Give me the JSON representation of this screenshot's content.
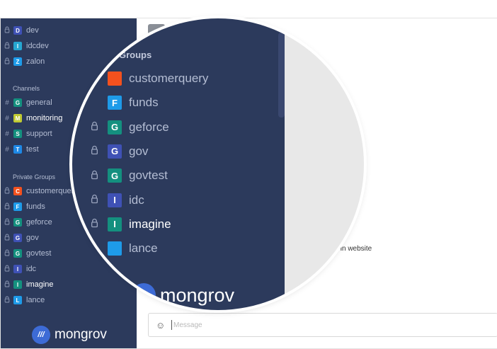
{
  "sidebar": {
    "direct": [
      {
        "prefix": "lock",
        "letter": "D",
        "color": "#3f51b5",
        "name": "dev"
      },
      {
        "prefix": "lock",
        "letter": "I",
        "color": "#26a6d1",
        "name": "idcdev"
      },
      {
        "prefix": "lock",
        "letter": "Z",
        "color": "#1e9be9",
        "name": "zalon"
      }
    ],
    "channels_title": "Channels",
    "channels": [
      {
        "prefix": "#",
        "letter": "G",
        "color": "#14907f",
        "name": "general",
        "active": false
      },
      {
        "prefix": "#",
        "letter": "M",
        "color": "#c0ca33",
        "name": "monitoring",
        "active": true
      },
      {
        "prefix": "#",
        "letter": "S",
        "color": "#14907f",
        "name": "support",
        "active": false
      },
      {
        "prefix": "#",
        "letter": "T",
        "color": "#1e88e5",
        "name": "test",
        "active": false
      }
    ],
    "groups_title": "Private Groups",
    "groups": [
      {
        "letter": "C",
        "color": "#f4511e",
        "name": "customerquery",
        "active": false
      },
      {
        "letter": "F",
        "color": "#1e9be9",
        "name": "funds",
        "active": false
      },
      {
        "letter": "G",
        "color": "#14907f",
        "name": "geforce",
        "active": false
      },
      {
        "letter": "G",
        "color": "#3f51b5",
        "name": "gov",
        "active": false
      },
      {
        "letter": "G",
        "color": "#14907f",
        "name": "govtest",
        "active": false
      },
      {
        "letter": "I",
        "color": "#3f51b5",
        "name": "idc",
        "active": false
      },
      {
        "letter": "I",
        "color": "#14907f",
        "name": "imagine",
        "active": true
      },
      {
        "letter": "L",
        "color": "#1e9be9",
        "name": "lance",
        "active": false
      }
    ],
    "brand": {
      "mark": "///",
      "name": "mongrov"
    }
  },
  "main": {
    "message_snippet": "x in website"
  },
  "composer": {
    "placeholder": "Message",
    "emoji_icon": "smile-icon"
  },
  "magnifier": {
    "section_title": "Groups",
    "rows": [
      {
        "prefix": "",
        "letter": "",
        "color": "#f4511e",
        "name": "customerquery",
        "active": false
      },
      {
        "prefix": "",
        "letter": "F",
        "color": "#1e9be9",
        "name": "funds",
        "active": false
      },
      {
        "prefix": "lock",
        "letter": "G",
        "color": "#14907f",
        "name": "geforce",
        "active": false
      },
      {
        "prefix": "lock",
        "letter": "G",
        "color": "#3f51b5",
        "name": "gov",
        "active": false
      },
      {
        "prefix": "lock",
        "letter": "G",
        "color": "#14907f",
        "name": "govtest",
        "active": false
      },
      {
        "prefix": "lock",
        "letter": "I",
        "color": "#3f51b5",
        "name": "idc",
        "active": false
      },
      {
        "prefix": "lock",
        "letter": "I",
        "color": "#14907f",
        "name": "imagine",
        "active": true
      },
      {
        "prefix": "",
        "letter": "",
        "color": "#1e9be9",
        "name": "lance",
        "active": false
      }
    ],
    "brand_name": "mongrov"
  }
}
